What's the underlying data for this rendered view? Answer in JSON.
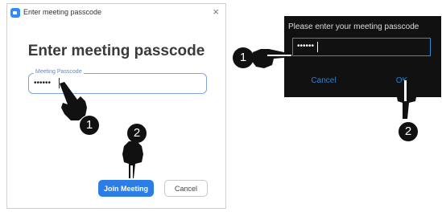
{
  "left_dialog": {
    "title": "Enter meeting passcode",
    "close_glyph": "×",
    "heading": "Enter meeting passcode",
    "field_label": "Meeting Passcode",
    "field_value": "••••••",
    "join_label": "Join Meeting",
    "cancel_label": "Cancel"
  },
  "right_dialog": {
    "title": "Please enter your meeting passcode",
    "field_value": "••••••",
    "cancel_label": "Cancel",
    "ok_label": "OK"
  },
  "annotations": {
    "step1": "1",
    "step2": "2"
  },
  "colors": {
    "accent_blue": "#2d7de6",
    "dark_bg": "#111111",
    "dark_link": "#2f7fc9"
  },
  "icons": [
    "zoom-app-icon",
    "close-icon",
    "pointing-hand-icon"
  ]
}
